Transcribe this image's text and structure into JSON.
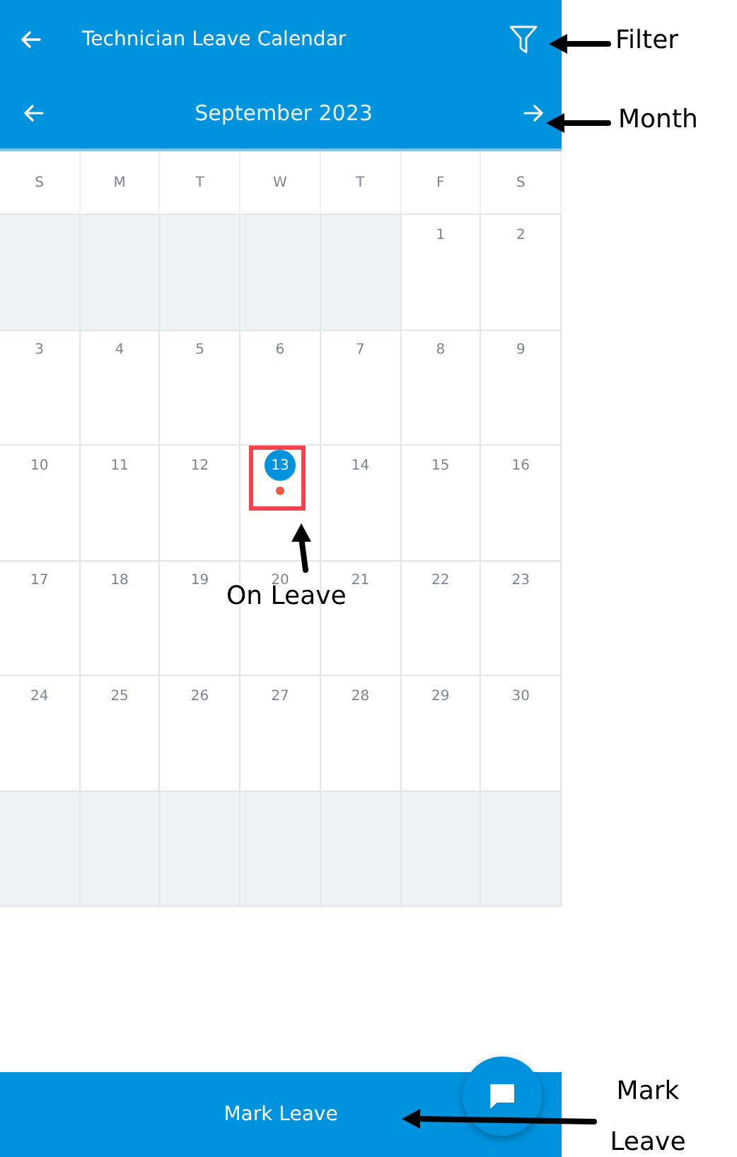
{
  "header": {
    "title": "Technician Leave Calendar"
  },
  "month_bar": {
    "label": "September 2023"
  },
  "weekdays": [
    "S",
    "M",
    "T",
    "W",
    "T",
    "F",
    "S"
  ],
  "weeks": [
    [
      {
        "outside": true
      },
      {
        "outside": true
      },
      {
        "outside": true
      },
      {
        "outside": true
      },
      {
        "outside": true
      },
      {
        "day": "1",
        "outside": false,
        "selected": false,
        "on_leave": false
      },
      {
        "day": "2",
        "outside": false,
        "selected": false,
        "on_leave": false
      }
    ],
    [
      {
        "day": "3",
        "outside": false,
        "selected": false,
        "on_leave": false
      },
      {
        "day": "4",
        "outside": false,
        "selected": false,
        "on_leave": false
      },
      {
        "day": "5",
        "outside": false,
        "selected": false,
        "on_leave": false
      },
      {
        "day": "6",
        "outside": false,
        "selected": false,
        "on_leave": false
      },
      {
        "day": "7",
        "outside": false,
        "selected": false,
        "on_leave": false
      },
      {
        "day": "8",
        "outside": false,
        "selected": false,
        "on_leave": false
      },
      {
        "day": "9",
        "outside": false,
        "selected": false,
        "on_leave": false
      }
    ],
    [
      {
        "day": "10",
        "outside": false,
        "selected": false,
        "on_leave": false
      },
      {
        "day": "11",
        "outside": false,
        "selected": false,
        "on_leave": false
      },
      {
        "day": "12",
        "outside": false,
        "selected": false,
        "on_leave": false
      },
      {
        "day": "13",
        "outside": false,
        "selected": true,
        "on_leave": true
      },
      {
        "day": "14",
        "outside": false,
        "selected": false,
        "on_leave": false
      },
      {
        "day": "15",
        "outside": false,
        "selected": false,
        "on_leave": false
      },
      {
        "day": "16",
        "outside": false,
        "selected": false,
        "on_leave": false
      }
    ],
    [
      {
        "day": "17",
        "outside": false,
        "selected": false,
        "on_leave": false
      },
      {
        "day": "18",
        "outside": false,
        "selected": false,
        "on_leave": false
      },
      {
        "day": "19",
        "outside": false,
        "selected": false,
        "on_leave": false
      },
      {
        "day": "20",
        "outside": false,
        "selected": false,
        "on_leave": false
      },
      {
        "day": "21",
        "outside": false,
        "selected": false,
        "on_leave": false
      },
      {
        "day": "22",
        "outside": false,
        "selected": false,
        "on_leave": false
      },
      {
        "day": "23",
        "outside": false,
        "selected": false,
        "on_leave": false
      }
    ],
    [
      {
        "day": "24",
        "outside": false,
        "selected": false,
        "on_leave": false
      },
      {
        "day": "25",
        "outside": false,
        "selected": false,
        "on_leave": false
      },
      {
        "day": "26",
        "outside": false,
        "selected": false,
        "on_leave": false
      },
      {
        "day": "27",
        "outside": false,
        "selected": false,
        "on_leave": false
      },
      {
        "day": "28",
        "outside": false,
        "selected": false,
        "on_leave": false
      },
      {
        "day": "29",
        "outside": false,
        "selected": false,
        "on_leave": false
      },
      {
        "day": "30",
        "outside": false,
        "selected": false,
        "on_leave": false
      }
    ],
    [
      {
        "outside": true
      },
      {
        "outside": true
      },
      {
        "outside": true
      },
      {
        "outside": true
      },
      {
        "outside": true
      },
      {
        "outside": true
      },
      {
        "outside": true
      }
    ]
  ],
  "bottom_button": {
    "label": "Mark Leave"
  },
  "annotations": [
    {
      "label": "Filter"
    },
    {
      "label": "Month"
    },
    {
      "label": "On Leave"
    },
    {
      "label": "Mark Leave"
    }
  ]
}
